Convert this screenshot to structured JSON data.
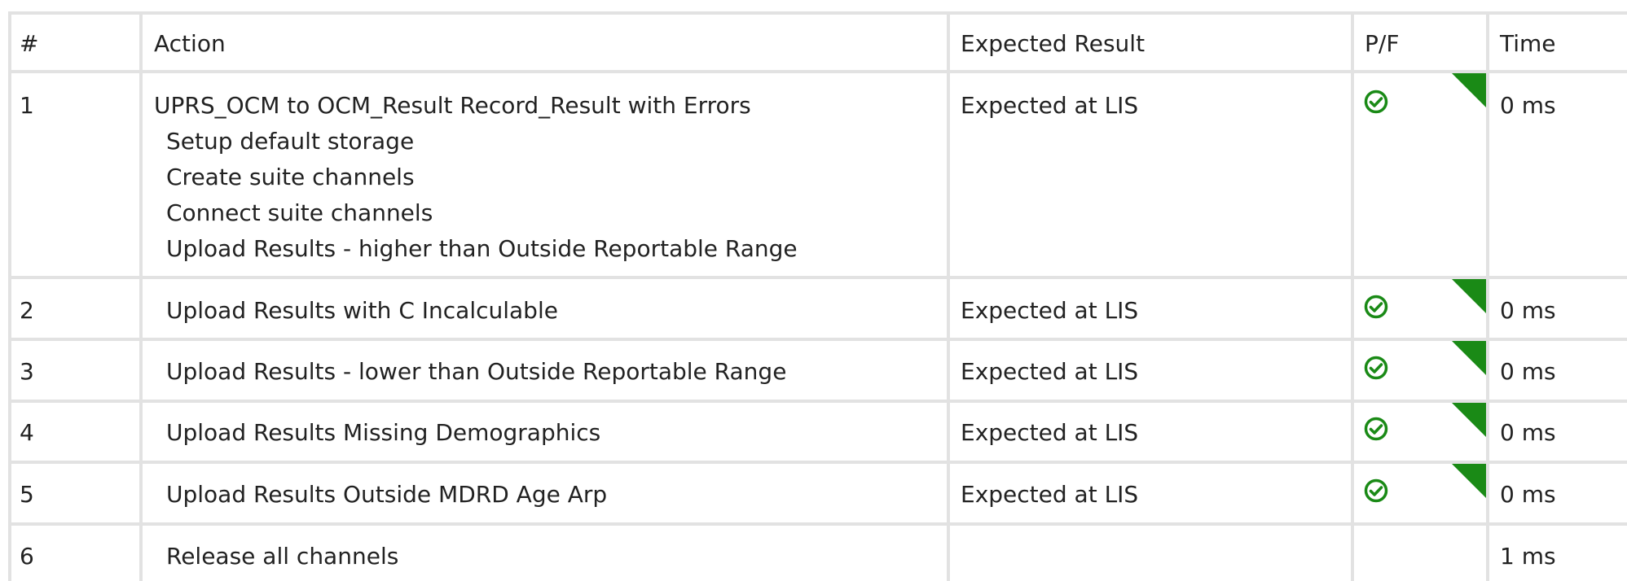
{
  "columns": [
    "#",
    "Action",
    "Expected Result",
    "P/F",
    "Time"
  ],
  "rows": [
    {
      "num": "1",
      "action": "UPRS_OCM to OCM_Result Record_Result with Errors",
      "sub_steps": [
        "Setup default storage",
        "Create suite channels",
        "Connect suite channels",
        "Upload Results - higher than Outside Reportable Range"
      ],
      "expected": "Expected at LIS",
      "status": "pass",
      "time": "0 ms"
    },
    {
      "num": "2",
      "action": "Upload Results with C Incalculable",
      "expected": "Expected at LIS",
      "status": "pass",
      "time": "0 ms"
    },
    {
      "num": "3",
      "action": "Upload Results - lower than Outside Reportable Range",
      "expected": "Expected at LIS",
      "status": "pass",
      "time": "0 ms"
    },
    {
      "num": "4",
      "action": "Upload Results Missing Demographics",
      "expected": "Expected at LIS",
      "status": "pass",
      "time": "0 ms"
    },
    {
      "num": "5",
      "action": "Upload Results Outside MDRD Age Arp",
      "expected": "Expected at LIS",
      "status": "pass",
      "time": "0 ms"
    },
    {
      "num": "6",
      "action": "Release all channels",
      "expected": "",
      "status": "",
      "time": "1 ms"
    }
  ],
  "colors": {
    "grid": "#e2e2e2",
    "pass": "#1a8a16",
    "text": "#222222"
  },
  "icons": {
    "pass": "check-circle-icon",
    "flag": "corner-flag-icon"
  }
}
